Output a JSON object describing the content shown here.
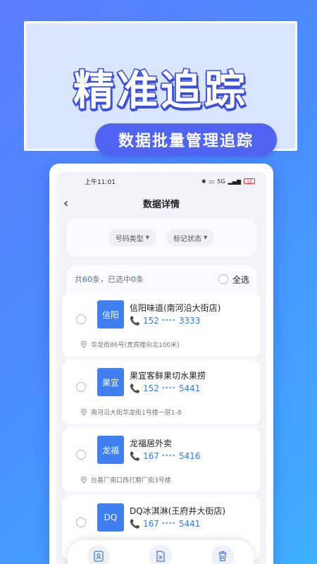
{
  "banner": {
    "title": "精准追踪",
    "subtitle": "数据批量管理追踪"
  },
  "status_bar": {
    "time": "上午11:01",
    "network": "5G",
    "battery": "15"
  },
  "nav": {
    "back_icon": "chevron-left-icon",
    "title": "数据详情"
  },
  "filters": [
    {
      "label": "号码类型"
    },
    {
      "label": "标记状态"
    }
  ],
  "list_summary": {
    "prefix": "共",
    "total": "60",
    "middle": "条，已选中",
    "selected": "0",
    "suffix": "条",
    "select_all": "全选"
  },
  "items": [
    {
      "avatar": "信阳",
      "name": "信阳味道(南河沿大街店)",
      "phone_prefix": "152",
      "phone_mask": "****",
      "phone_suffix": "3333",
      "address": "华龙街86号(贵宾楼向北100米)"
    },
    {
      "avatar": "果宜",
      "name": "果宜客鲜果切水果捞",
      "phone_prefix": "152",
      "phone_mask": "****",
      "phone_suffix": "5441",
      "address": "南河沿大街华龙街1号楼一层1-8"
    },
    {
      "avatar": "龙福",
      "name": "龙福居外卖",
      "phone_prefix": "167",
      "phone_mask": "****",
      "phone_suffix": "5416",
      "address": "台基厂南口西打磨厂街3号楼"
    },
    {
      "avatar": "DQ",
      "name": "DQ冰淇淋(王府井大街店)",
      "phone_prefix": "167",
      "phone_mask": "****",
      "phone_suffix": "5441",
      "address": ""
    }
  ],
  "toolbar": {
    "icons": [
      "contact-card-icon",
      "export-excel-icon",
      "trash-icon"
    ]
  },
  "colors": {
    "accent": "#3f7ff0",
    "phone_text": "#3b7bd6",
    "banner_pill": "#4f64f2"
  }
}
